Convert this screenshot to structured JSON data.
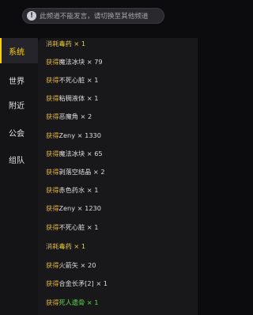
{
  "notice": {
    "text": "此频道不能发言，请切换至其他频道"
  },
  "tabs": [
    {
      "label": "系统",
      "active": true
    },
    {
      "label": "世界",
      "active": false
    },
    {
      "label": "附近",
      "active": false
    },
    {
      "label": "公会",
      "active": false
    },
    {
      "label": "组队",
      "active": false
    }
  ],
  "log": [
    {
      "verb": "消耗",
      "item": "毒药 × 1",
      "item_color": "yellow"
    },
    {
      "verb": "获得",
      "item": "魔法冰块 × 79",
      "item_color": "white"
    },
    {
      "verb": "获得",
      "item": "不死心脏 × 1",
      "item_color": "white"
    },
    {
      "verb": "获得",
      "item": "粘稠液体 × 1",
      "item_color": "white"
    },
    {
      "verb": "获得",
      "item": "恶魔角 × 2",
      "item_color": "white"
    },
    {
      "verb": "获得",
      "item": "Zeny × 1330",
      "item_color": "white"
    },
    {
      "verb": "获得",
      "item": "魔法冰块 × 65",
      "item_color": "white"
    },
    {
      "verb": "获得",
      "item": "剥落空结晶 × 2",
      "item_color": "white"
    },
    {
      "verb": "获得",
      "item": "赤色药水 × 1",
      "item_color": "white"
    },
    {
      "verb": "获得",
      "item": "Zeny × 1230",
      "item_color": "white"
    },
    {
      "verb": "获得",
      "item": "不死心脏 × 1",
      "item_color": "white"
    },
    {
      "verb": "消耗",
      "item": "毒药 × 1",
      "item_color": "yellow"
    },
    {
      "verb": "获得",
      "item": "火箭矢 × 20",
      "item_color": "white"
    },
    {
      "verb": "获得",
      "item": "合金长矛[2] × 1",
      "item_color": "white"
    },
    {
      "verb": "获得",
      "item": "死人遗骨 × 1",
      "item_color": "green"
    }
  ]
}
